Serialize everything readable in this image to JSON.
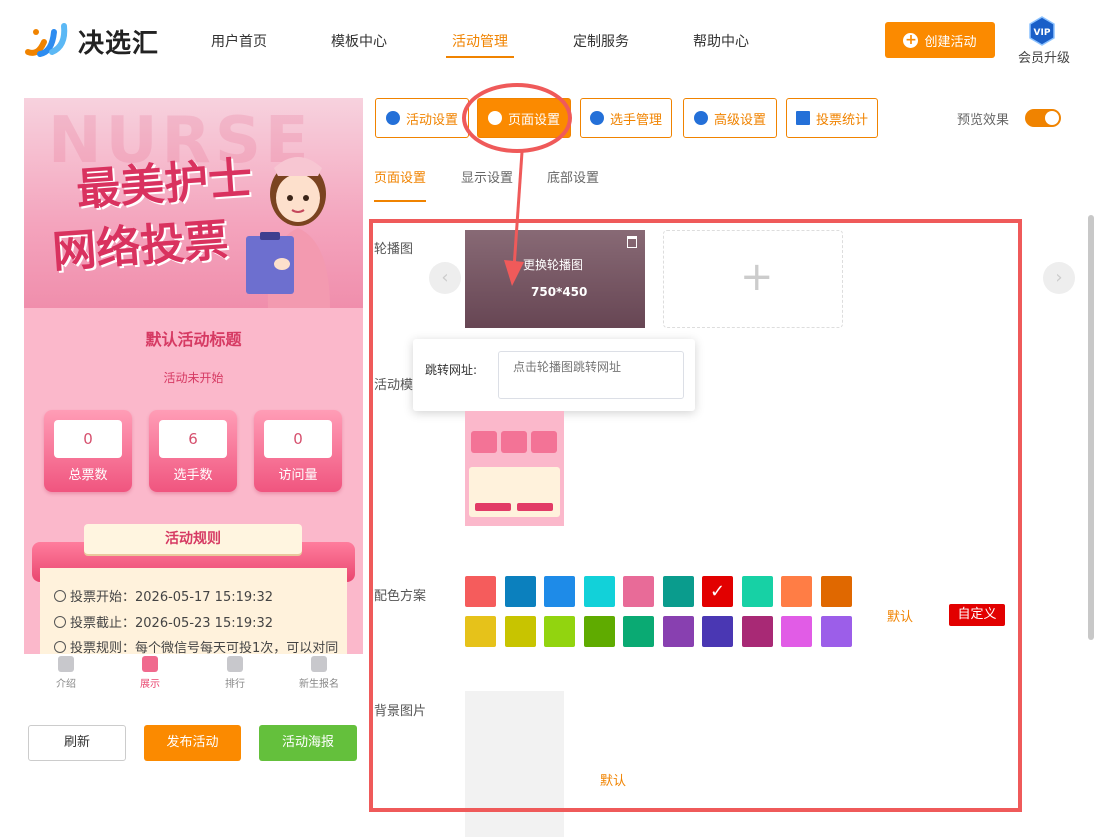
{
  "header": {
    "logo_text": "决选汇",
    "nav": [
      "用户首页",
      "模板中心",
      "活动管理",
      "定制服务",
      "帮助中心"
    ],
    "active_nav": "活动管理",
    "create_button": "创建活动",
    "vip_badge": "VIP",
    "vip_label": "会员升级"
  },
  "preview": {
    "banner_watermark": "NURSE",
    "banner_line1": "最美护士",
    "banner_line2": "网络投票",
    "activity_title": "默认活动标题",
    "activity_status": "活动未开始",
    "stats": [
      {
        "value": "0",
        "label": "总票数"
      },
      {
        "value": "6",
        "label": "选手数"
      },
      {
        "value": "0",
        "label": "访问量"
      }
    ],
    "rules_title": "活动规则",
    "rules": [
      "投票开始：2026-05-17 15:19:32",
      "投票截止：2026-05-23 15:19:32",
      "投票规则：每个微信号每天可投1次，可以对同"
    ],
    "tabbar": [
      "介绍",
      "展示",
      "排行",
      "新生报名"
    ],
    "active_tab": "展示"
  },
  "actions": {
    "refresh": "刷新",
    "publish": "发布活动",
    "poster": "活动海报"
  },
  "toolbar": {
    "tabs": [
      "活动设置",
      "页面设置",
      "选手管理",
      "高级设置",
      "投票统计"
    ],
    "active": "页面设置",
    "preview_label": "预览效果",
    "preview_enabled": true
  },
  "subtabs": [
    "页面设置",
    "显示设置",
    "底部设置"
  ],
  "active_subtab": "页面设置",
  "settings": {
    "carousel_label": "轮播图",
    "carousel_replace": "更换轮播图",
    "carousel_size": "750*450",
    "link_label": "跳转网址:",
    "link_placeholder": "点击轮播图跳转网址",
    "template_label": "活动模",
    "color_label": "配色方案",
    "colors_row1": [
      "#f55c5c",
      "#0b80be",
      "#1e8be8",
      "#12d1d9",
      "#e86b98",
      "#0a9c8d",
      "#e20000",
      "#17d1a5",
      "#ff7d45",
      "#e06800"
    ],
    "colors_row2": [
      "#e6c21a",
      "#c8c400",
      "#92d40f",
      "#5fab00",
      "#0aaa73",
      "#8840b0",
      "#4a37b3",
      "#a82975",
      "#e15ce6",
      "#9c5ee9"
    ],
    "selected_color_index": 6,
    "color_default": "默认",
    "color_custom": "自定义",
    "bg_label": "背景图片",
    "bg_default": "默认"
  },
  "colors": {
    "accent": "#f08300",
    "annotation": "#ef5a5a"
  }
}
